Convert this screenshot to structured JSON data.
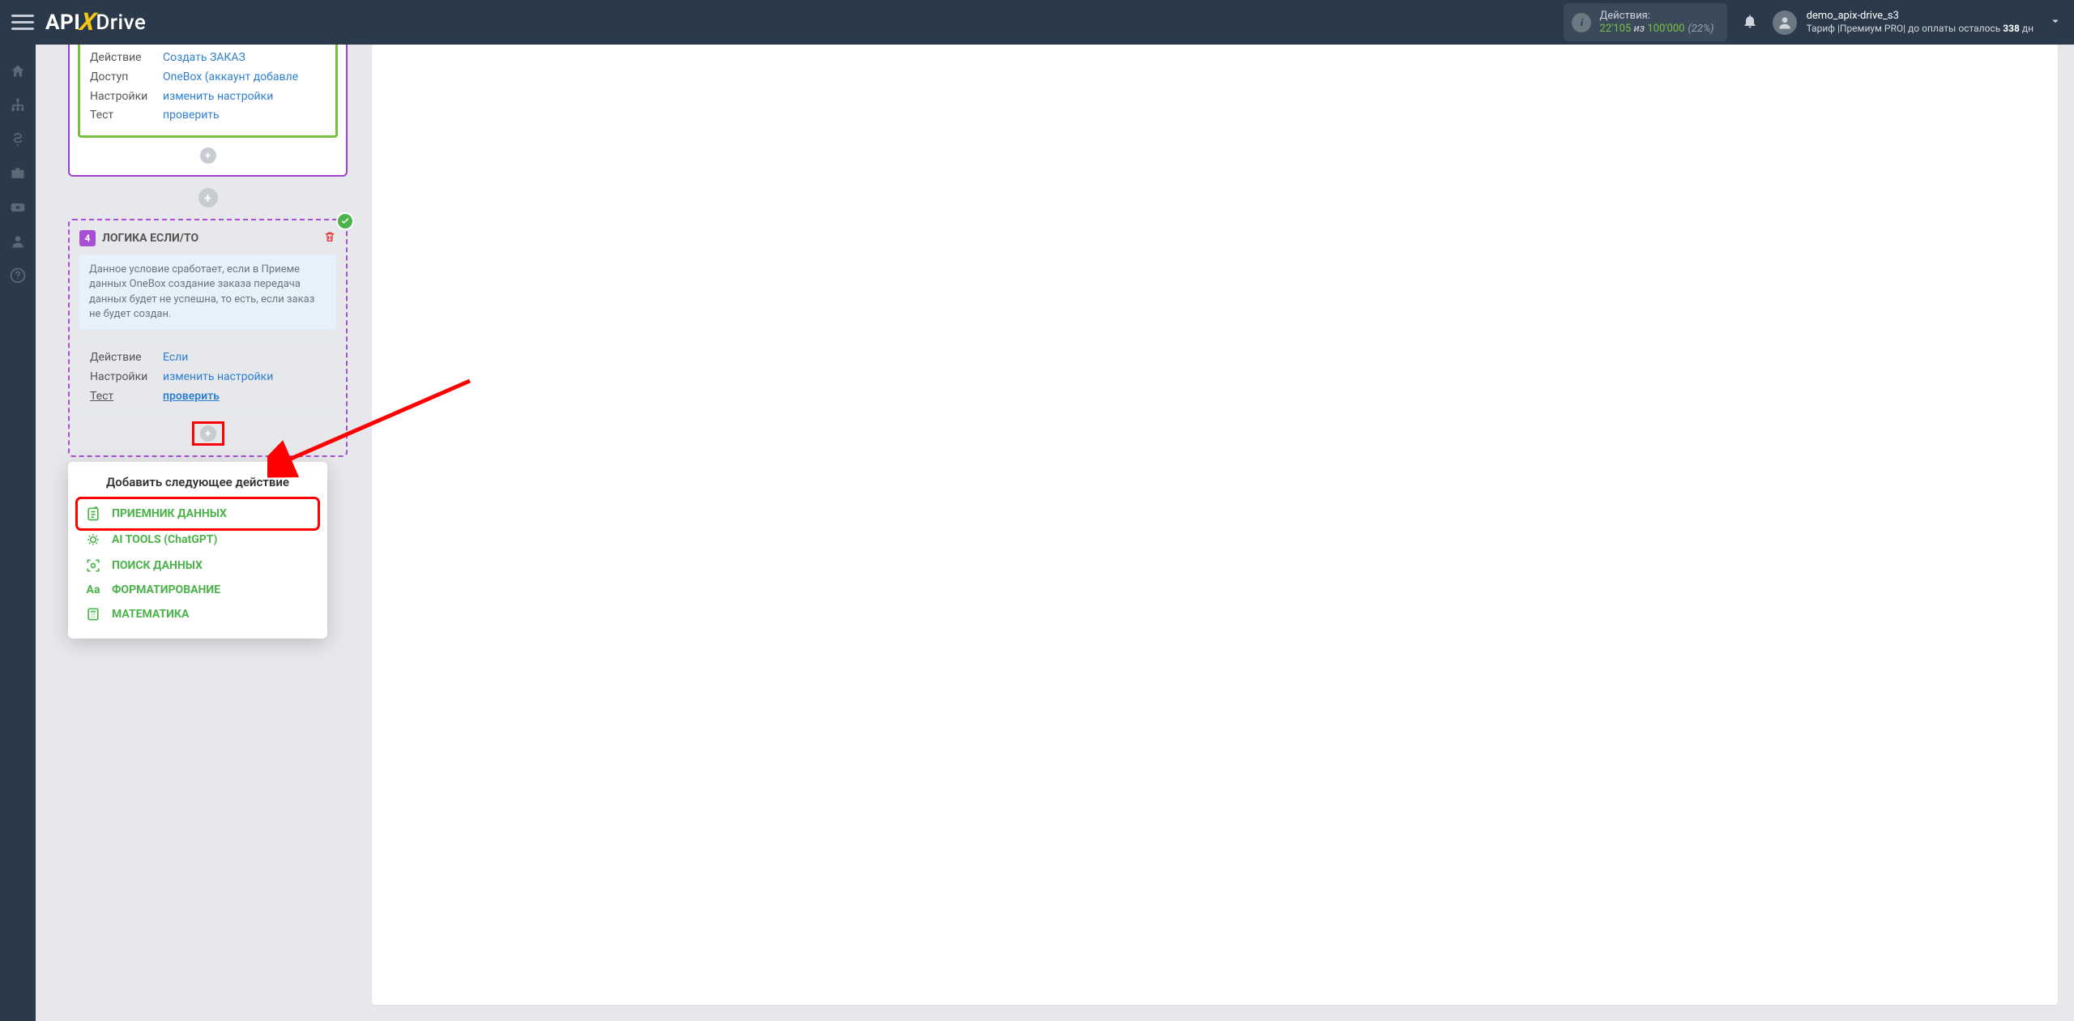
{
  "topbar": {
    "logo": {
      "api": "API",
      "x": "X",
      "drive": "Drive"
    },
    "actions": {
      "label": "Действия:",
      "current": "22'105",
      "of": " из ",
      "max": "100'000",
      "pct": "(22%)"
    },
    "user": {
      "name": "demo_apix-drive_s3",
      "tariff_prefix": "Тариф |Премиум PRO| до оплаты осталось ",
      "days": "338",
      "days_suffix": " дн"
    }
  },
  "card_prev": {
    "rows": [
      {
        "k": "Действие",
        "v": "Создать ЗАКАЗ"
      },
      {
        "k": "Доступ",
        "v": "OneBox (аккаунт добавле"
      },
      {
        "k": "Настройки",
        "v": "изменить настройки"
      },
      {
        "k": "Тест",
        "v": "проверить"
      }
    ]
  },
  "logic": {
    "step": "4",
    "title": "ЛОГИКА ЕСЛИ/ТО",
    "desc": "Данное условие сработает, если в Приеме данных OneBox создание заказа передача данных будет не успешна, то есть, если заказ не будет создан.",
    "rows": [
      {
        "k": "Действие",
        "v": "Если",
        "underline": false,
        "ku": false
      },
      {
        "k": "Настройки",
        "v": "изменить настройки",
        "underline": false,
        "ku": false
      },
      {
        "k": "Тест",
        "v": "проверить",
        "underline": true,
        "ku": true
      }
    ]
  },
  "popup": {
    "title": "Добавить следующее действие",
    "items": [
      {
        "label": "ПРИЕМНИК ДАННЫХ",
        "icon": "doc-plus",
        "hl": true
      },
      {
        "label": "AI TOOLS (ChatGPT)",
        "icon": "brain",
        "hl": false
      },
      {
        "label": "ПОИСК ДАННЫХ",
        "icon": "scan",
        "hl": false
      },
      {
        "label": "ФОРМАТИРОВАНИЕ",
        "icon": "Aa",
        "hl": false
      },
      {
        "label": "МАТЕМАТИКА",
        "icon": "calc",
        "hl": false
      }
    ]
  }
}
